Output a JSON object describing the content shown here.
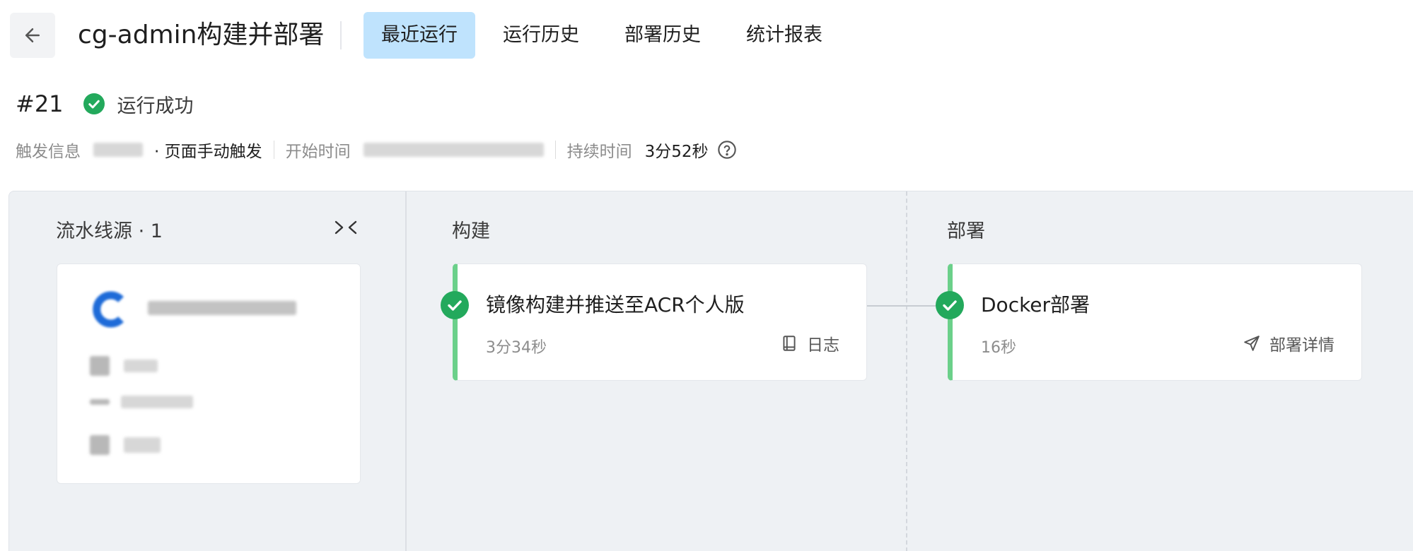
{
  "header": {
    "title": "cg-admin构建并部署",
    "tabs": [
      {
        "label": "最近运行",
        "active": true
      },
      {
        "label": "运行历史",
        "active": false
      },
      {
        "label": "部署历史",
        "active": false
      },
      {
        "label": "统计报表",
        "active": false
      }
    ]
  },
  "run": {
    "number": "#21",
    "status": "运行成功",
    "status_color": "#23a95c",
    "trigger_label": "触发信息",
    "trigger_method": "· 页面手动触发",
    "start_label": "开始时间",
    "duration_label": "持续时间",
    "duration": "3分52秒"
  },
  "pipeline": {
    "source": {
      "title": "流水线源 · 1"
    },
    "stages": [
      {
        "title": "构建",
        "job": {
          "name": "镜像构建并推送至ACR个人版",
          "duration": "3分34秒",
          "action": "日志",
          "action_icon": "book-icon"
        }
      },
      {
        "title": "部署",
        "job": {
          "name": "Docker部署",
          "duration": "16秒",
          "action": "部署详情",
          "action_icon": "send-icon"
        }
      }
    ]
  },
  "colors": {
    "active_tab": "#bfe3fd",
    "success": "#23a95c",
    "job_stripe": "#6bd08a",
    "canvas_bg": "#eef1f4"
  }
}
